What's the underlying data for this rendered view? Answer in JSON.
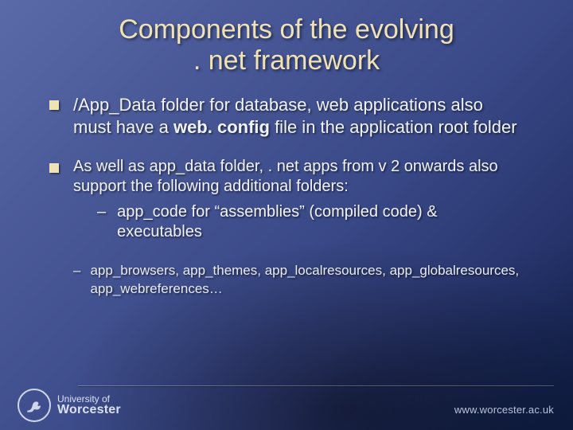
{
  "title_line1": "Components of the evolving",
  "title_line2": ". net framework",
  "bullet1_a": "/App_Data folder for database, web applications also must have a ",
  "bullet1_bold": "web. config",
  "bullet1_b": " file in the application root folder",
  "bullet2": "As well as app_data folder, . net apps from v 2 onwards also support the following additional folders:",
  "bullet2_sub1": "app_code for “assemblies” (compiled code) & executables",
  "bullet2_sub2": "app_browsers, app_themes, app_localresources, app_globalresources, app_webreferences…",
  "logo_line1": "University of",
  "logo_line2": "Worcester",
  "url": "www.worcester.ac.uk"
}
